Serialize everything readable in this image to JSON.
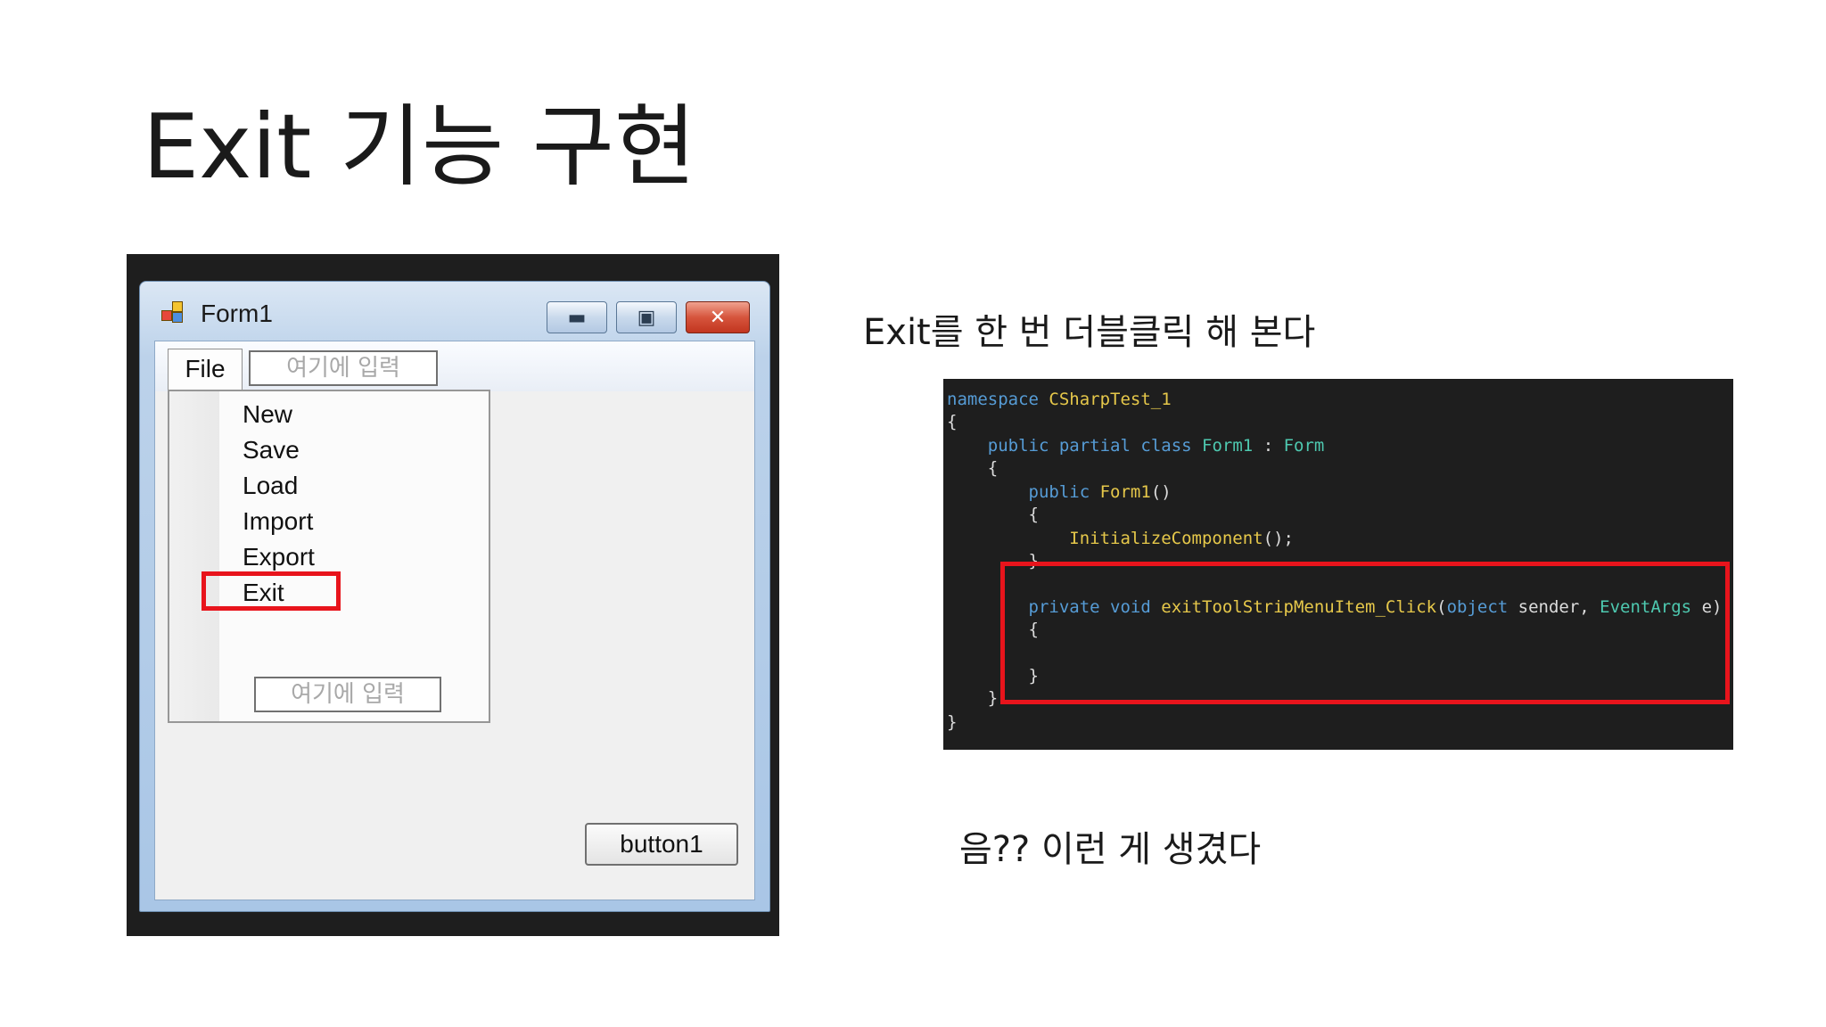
{
  "slide": {
    "title": "Exit 기능 구현",
    "caption_top": "Exit를 한 번 더블클릭 해 본다",
    "caption_bottom": "음?? 이런 게 생겼다"
  },
  "form": {
    "title": "Form1",
    "controls": {
      "minimize_icon": "minimize-icon",
      "maximize_icon": "maximize-icon",
      "close_icon": "close-icon"
    },
    "menubar": {
      "file_label": "File",
      "type_here_label": "여기에 입력"
    },
    "file_menu": {
      "items": [
        "New",
        "Save",
        "Load",
        "Import",
        "Export",
        "Exit"
      ],
      "type_here_label": "여기에 입력",
      "highlighted_item": "Exit"
    },
    "button1_label": "button1"
  },
  "code": {
    "line1_kw": "namespace",
    "line1_name": "CSharpTest_1",
    "brace_open": "{",
    "brace_close": "}",
    "class_public": "public",
    "class_partial": "partial",
    "class_class": "class",
    "class_name": "Form1",
    "class_colon": ":",
    "class_base": "Form",
    "ctor_public": "public",
    "ctor_name": "Form1",
    "ctor_parens": "()",
    "init_call": "InitializeComponent",
    "init_tail": "();",
    "handler_private": "private",
    "handler_void": "void",
    "handler_name": "exitToolStripMenuItem_Click",
    "handler_open": "(",
    "handler_object": "object",
    "handler_sender": " sender, ",
    "handler_eventargs": "EventArgs",
    "handler_e": " e)"
  },
  "colors": {
    "highlight": "#e8141c",
    "code_background": "#1e1e1e",
    "keyword": "#569cd6",
    "type": "#4ec9b0"
  }
}
